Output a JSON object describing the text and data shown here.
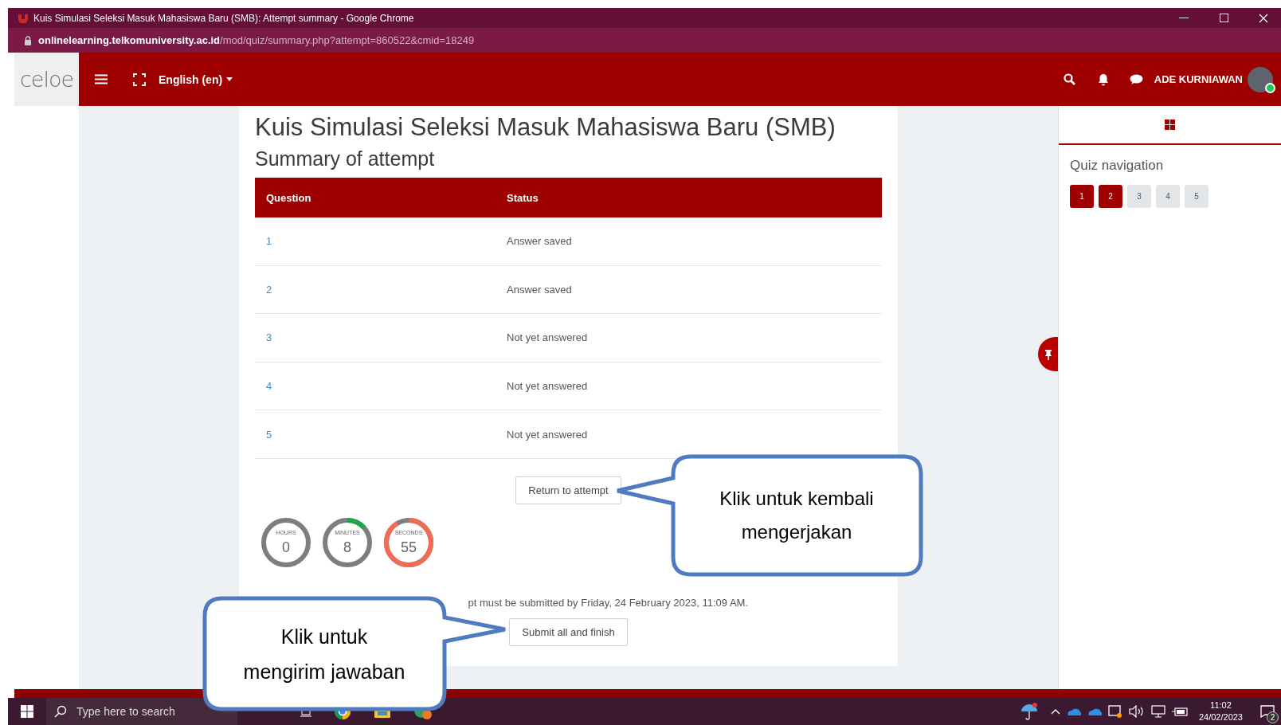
{
  "browser": {
    "title": "Kuis Simulasi Seleksi Masuk Mahasiswa Baru (SMB): Attempt summary - Google Chrome",
    "url_host": "onlinelearning.telkomuniversity.ac.id",
    "url_path": "/mod/quiz/summary.php?attempt=860522&cmid=18249"
  },
  "header": {
    "logo": "celoe",
    "language": "English (en)",
    "user_name": "ADE KURNIAWAN"
  },
  "quiz": {
    "title": "Kuis Simulasi Seleksi Masuk Mahasiswa Baru (SMB)",
    "subtitle": "Summary of attempt",
    "columns": [
      "Question",
      "Status"
    ],
    "rows": [
      {
        "question": "1",
        "status": "Answer saved"
      },
      {
        "question": "2",
        "status": "Answer saved"
      },
      {
        "question": "3",
        "status": "Not yet answered"
      },
      {
        "question": "4",
        "status": "Not yet answered"
      },
      {
        "question": "5",
        "status": "Not yet answered"
      }
    ],
    "return_button": "Return to attempt",
    "timer": [
      {
        "label": "HOURS",
        "value": "0"
      },
      {
        "label": "MINUTES",
        "value": "8"
      },
      {
        "label": "SECONDS",
        "value": "55"
      }
    ],
    "deadline_text": "pt must be submitted by Friday, 24 February 2023, 11:09 AM.",
    "submit_button": "Submit all and finish"
  },
  "quiz_navigation": {
    "title": "Quiz navigation",
    "questions": [
      {
        "label": "1",
        "answered": true
      },
      {
        "label": "2",
        "answered": true
      },
      {
        "label": "3",
        "answered": false
      },
      {
        "label": "4",
        "answered": false
      },
      {
        "label": "5",
        "answered": false
      }
    ]
  },
  "callouts": [
    {
      "text": "Klik untuk kembali mengerjakan"
    },
    {
      "text": "Klik untuk mengirim jawaban"
    }
  ],
  "taskbar": {
    "search_placeholder": "Type here to search",
    "time": "11:02",
    "date": "24/02/2023",
    "notification_count": "2"
  }
}
